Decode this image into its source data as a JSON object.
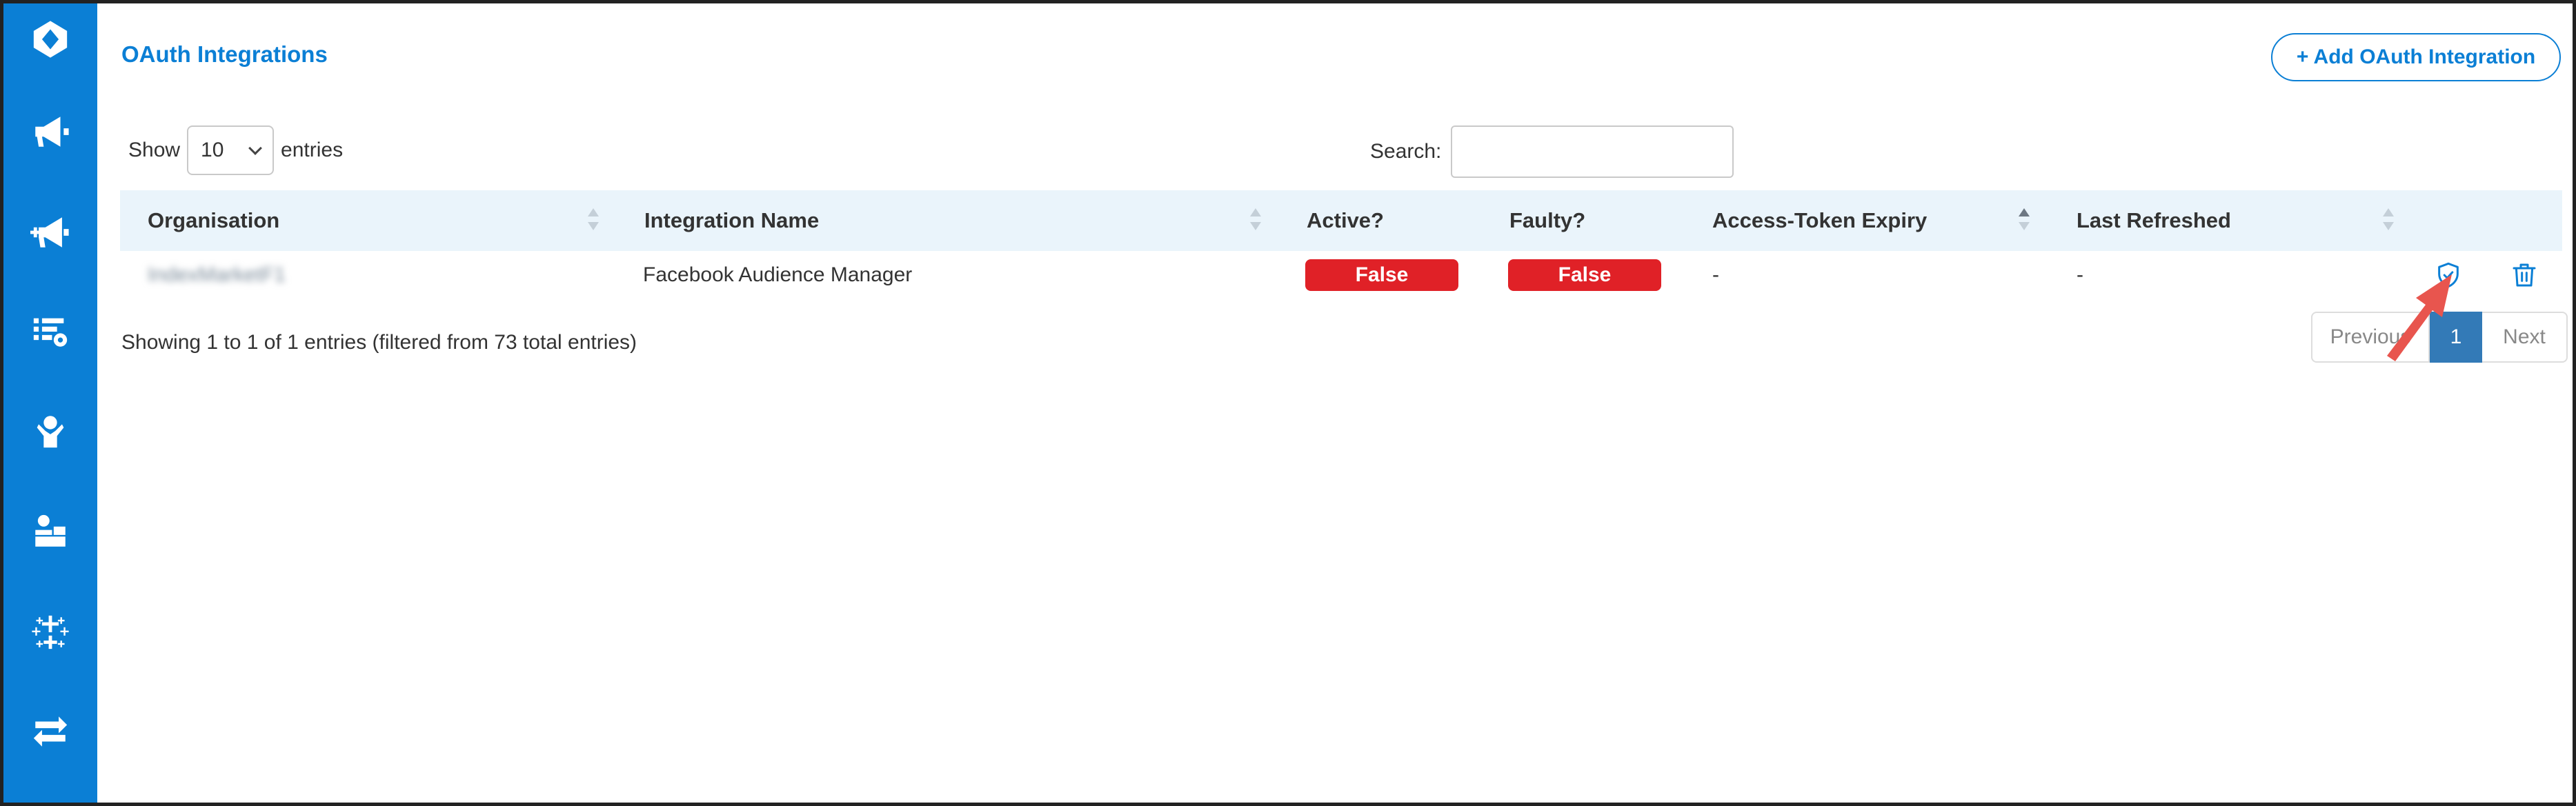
{
  "sidebar": {
    "items": [
      {
        "icon": "logo-icon"
      },
      {
        "icon": "megaphone-icon"
      },
      {
        "icon": "megaphone-add-icon"
      },
      {
        "icon": "list-settings-icon"
      },
      {
        "icon": "user-support-icon"
      },
      {
        "icon": "user-desk-icon"
      },
      {
        "icon": "tableau-icon"
      },
      {
        "icon": "transfer-arrows-icon"
      }
    ],
    "color": "#0b7fd5"
  },
  "header": {
    "title": "OAuth Integrations",
    "add_button_label": "+ Add OAuth Integration"
  },
  "controls": {
    "show_label": "Show",
    "entries_value": "10",
    "entries_label": "entries",
    "search_label": "Search:",
    "search_value": ""
  },
  "table": {
    "columns": [
      {
        "label": "Organisation",
        "sortable": true
      },
      {
        "label": "Integration Name",
        "sortable": true
      },
      {
        "label": "Active?",
        "sortable": false
      },
      {
        "label": "Faulty?",
        "sortable": false
      },
      {
        "label": "Access-Token Expiry",
        "sortable": true,
        "sorted": "asc"
      },
      {
        "label": "Last Refreshed",
        "sortable": true
      }
    ],
    "rows": [
      {
        "organisation": "IndexMarketF1",
        "integration_name": "Facebook Audience Manager",
        "active": "False",
        "faulty": "False",
        "access_token_expiry": "-",
        "last_refreshed": "-",
        "actions": [
          "shield-check-icon",
          "trash-icon"
        ]
      }
    ]
  },
  "footer": {
    "info": "Showing 1 to 1 of 1 entries (filtered from 73 total entries)",
    "pagination": {
      "previous": "Previous",
      "current": "1",
      "next": "Next"
    }
  },
  "colors": {
    "accent": "#0b7fd5",
    "danger": "#e02127",
    "header_bg": "#eaf4fb",
    "page_active": "#337ab7",
    "annotation_arrow": "#e8554e"
  }
}
